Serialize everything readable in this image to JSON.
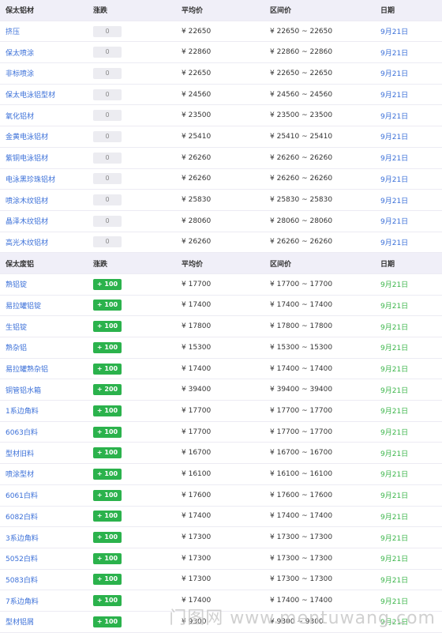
{
  "section1": {
    "headers": {
      "name": "保太铝材",
      "change": "涨跌",
      "avg": "平均价",
      "range": "区间价",
      "date": "日期"
    },
    "rows": [
      {
        "name": "挤压",
        "change": "0",
        "avg": "¥ 22650",
        "range": "¥ 22650 ~ 22650",
        "date": "9月21日"
      },
      {
        "name": "保太喷涂",
        "change": "0",
        "avg": "¥ 22860",
        "range": "¥ 22860 ~ 22860",
        "date": "9月21日"
      },
      {
        "name": "非标喷涂",
        "change": "0",
        "avg": "¥ 22650",
        "range": "¥ 22650 ~ 22650",
        "date": "9月21日"
      },
      {
        "name": "保太电泳铝型材",
        "change": "0",
        "avg": "¥ 24560",
        "range": "¥ 24560 ~ 24560",
        "date": "9月21日"
      },
      {
        "name": "氧化铝材",
        "change": "0",
        "avg": "¥ 23500",
        "range": "¥ 23500 ~ 23500",
        "date": "9月21日"
      },
      {
        "name": "金黄电泳铝材",
        "change": "0",
        "avg": "¥ 25410",
        "range": "¥ 25410 ~ 25410",
        "date": "9月21日"
      },
      {
        "name": "紫铜电泳铝材",
        "change": "0",
        "avg": "¥ 26260",
        "range": "¥ 26260 ~ 26260",
        "date": "9月21日"
      },
      {
        "name": "电泳黑珍珠铝材",
        "change": "0",
        "avg": "¥ 26260",
        "range": "¥ 26260 ~ 26260",
        "date": "9月21日"
      },
      {
        "name": "喷涂木纹铝材",
        "change": "0",
        "avg": "¥ 25830",
        "range": "¥ 25830 ~ 25830",
        "date": "9月21日"
      },
      {
        "name": "晶泽木纹铝材",
        "change": "0",
        "avg": "¥ 28060",
        "range": "¥ 28060 ~ 28060",
        "date": "9月21日"
      },
      {
        "name": "高光木纹铝材",
        "change": "0",
        "avg": "¥ 26260",
        "range": "¥ 26260 ~ 26260",
        "date": "9月21日"
      }
    ]
  },
  "section2": {
    "headers": {
      "name": "保太废铝",
      "change": "涨跌",
      "avg": "平均价",
      "range": "区间价",
      "date": "日期"
    },
    "rows": [
      {
        "name": "熟铝锭",
        "change": "+ 100",
        "avg": "¥ 17700",
        "range": "¥ 17700 ~ 17700",
        "date": "9月21日"
      },
      {
        "name": "易拉罐铝锭",
        "change": "+ 100",
        "avg": "¥ 17400",
        "range": "¥ 17400 ~ 17400",
        "date": "9月21日"
      },
      {
        "name": "生铝锭",
        "change": "+ 100",
        "avg": "¥ 17800",
        "range": "¥ 17800 ~ 17800",
        "date": "9月21日"
      },
      {
        "name": "熟杂铝",
        "change": "+ 100",
        "avg": "¥ 15300",
        "range": "¥ 15300 ~ 15300",
        "date": "9月21日"
      },
      {
        "name": "易拉罐熟杂铝",
        "change": "+ 100",
        "avg": "¥ 17400",
        "range": "¥ 17400 ~ 17400",
        "date": "9月21日"
      },
      {
        "name": "铜管铝水箱",
        "change": "+ 200",
        "avg": "¥ 39400",
        "range": "¥ 39400 ~ 39400",
        "date": "9月21日"
      },
      {
        "name": "1系边角料",
        "change": "+ 100",
        "avg": "¥ 17700",
        "range": "¥ 17700 ~ 17700",
        "date": "9月21日"
      },
      {
        "name": "6063白料",
        "change": "+ 100",
        "avg": "¥ 17700",
        "range": "¥ 17700 ~ 17700",
        "date": "9月21日"
      },
      {
        "name": "型材旧料",
        "change": "+ 100",
        "avg": "¥ 16700",
        "range": "¥ 16700 ~ 16700",
        "date": "9月21日"
      },
      {
        "name": "喷涂型材",
        "change": "+ 100",
        "avg": "¥ 16100",
        "range": "¥ 16100 ~ 16100",
        "date": "9月21日"
      },
      {
        "name": "6061白料",
        "change": "+ 100",
        "avg": "¥ 17600",
        "range": "¥ 17600 ~ 17600",
        "date": "9月21日"
      },
      {
        "name": "6082白料",
        "change": "+ 100",
        "avg": "¥ 17400",
        "range": "¥ 17400 ~ 17400",
        "date": "9月21日"
      },
      {
        "name": "3系边角料",
        "change": "+ 100",
        "avg": "¥ 17300",
        "range": "¥ 17300 ~ 17300",
        "date": "9月21日"
      },
      {
        "name": "5052白料",
        "change": "+ 100",
        "avg": "¥ 17300",
        "range": "¥ 17300 ~ 17300",
        "date": "9月21日"
      },
      {
        "name": "5083白料",
        "change": "+ 100",
        "avg": "¥ 17300",
        "range": "¥ 17300 ~ 17300",
        "date": "9月21日"
      },
      {
        "name": "7系边角料",
        "change": "+ 100",
        "avg": "¥ 17400",
        "range": "¥ 17400 ~ 17400",
        "date": "9月21日"
      },
      {
        "name": "型材铝屑",
        "change": "+ 100",
        "avg": "¥ 9300",
        "range": "¥ 9300 ~ 9300",
        "date": "9月21日"
      }
    ]
  },
  "watermark": "门图网 www.mentuwang.com",
  "colors": {
    "link": "#3a6fd8",
    "up": "#2bb24c",
    "header_bg": "#f0eff8",
    "date_green": "#3bb54a"
  }
}
